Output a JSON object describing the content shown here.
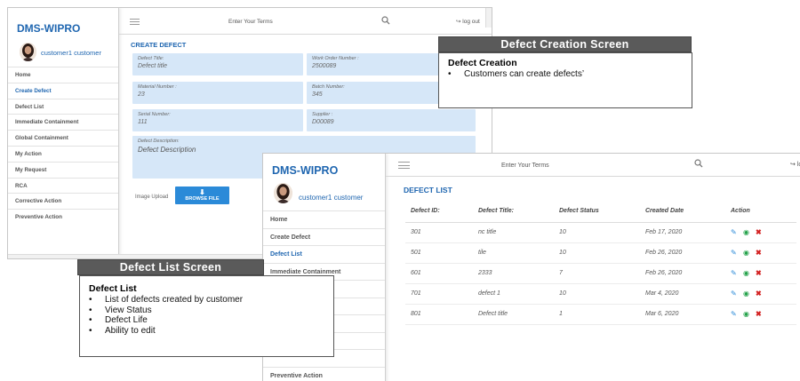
{
  "create_screen": {
    "brand": "DMS-WIPRO",
    "user_name": "customer1 customer",
    "nav": [
      {
        "label": "Home",
        "active": false
      },
      {
        "label": "Create Defect",
        "active": true
      },
      {
        "label": "Defect List",
        "active": false
      },
      {
        "label": "Immediate Containment",
        "active": false
      },
      {
        "label": "Global Containment",
        "active": false
      },
      {
        "label": "My Action",
        "active": false
      },
      {
        "label": "My Request",
        "active": false
      },
      {
        "label": "RCA",
        "active": false
      },
      {
        "label": "Corrective Action",
        "active": false
      },
      {
        "label": "Preventive Action",
        "active": false
      }
    ],
    "search_placeholder": "Enter Your Terms",
    "logout_label": "log out",
    "page_title": "CREATE DEFECT",
    "fields": {
      "defect_title": {
        "label": "Defect Title:",
        "value": "Defect title"
      },
      "work_order": {
        "label": "Work Order Number :",
        "value": "2500089"
      },
      "material_number": {
        "label": "Material Number :",
        "value": "23"
      },
      "batch_number": {
        "label": "Batch Number:",
        "value": "345"
      },
      "serial_number": {
        "label": "Serial Number:",
        "value": "111"
      },
      "supplier": {
        "label": "Supplier :",
        "value": "D00089"
      },
      "defect_description": {
        "label": "Defect Description:",
        "value": "Defect Description"
      }
    },
    "image_upload_label": "Image Upload",
    "browse_label": "BROWSE FILE"
  },
  "list_screen": {
    "brand": "DMS-WIPRO",
    "user_name": "customer1 customer",
    "nav": [
      {
        "label": "Home",
        "active": false
      },
      {
        "label": "Create Defect",
        "active": false
      },
      {
        "label": "Defect List",
        "active": true
      },
      {
        "label": "Immediate Containment",
        "active": false
      },
      {
        "label": "",
        "active": false
      },
      {
        "label": "",
        "active": false
      },
      {
        "label": "",
        "active": false
      },
      {
        "label": "",
        "active": false
      },
      {
        "label": "",
        "active": false
      },
      {
        "label": "Preventive Action",
        "active": false
      }
    ],
    "search_placeholder": "Enter Your Terms",
    "logout_label": "lo",
    "page_title": "DEFECT LIST",
    "columns": [
      "Defect ID:",
      "Defect Title:",
      "Defect Status",
      "Created Date",
      "Action"
    ],
    "rows": [
      {
        "id": "301",
        "title": "nc title",
        "status": "10",
        "date": "Feb 17, 2020"
      },
      {
        "id": "501",
        "title": "tile",
        "status": "10",
        "date": "Feb 26, 2020"
      },
      {
        "id": "601",
        "title": "2333",
        "status": "7",
        "date": "Feb 26, 2020"
      },
      {
        "id": "701",
        "title": "defect 1",
        "status": "10",
        "date": "Mar 4, 2020"
      },
      {
        "id": "801",
        "title": "Defect title",
        "status": "1",
        "date": "Mar 6, 2020"
      }
    ]
  },
  "callouts": {
    "creation": {
      "heading": "Defect Creation Screen",
      "title": "Defect Creation",
      "bullets": [
        "Customers can create defects’"
      ]
    },
    "list": {
      "heading": "Defect List Screen",
      "title": "Defect List",
      "bullets": [
        "List of defects created by customer",
        "View Status",
        "Defect Life",
        "Ability to edit"
      ]
    }
  },
  "colors": {
    "brand_blue": "#1f66b0",
    "field_bg": "#d6e7f8",
    "button_blue": "#2b8ad8",
    "callout_header": "#5a5a5a"
  }
}
